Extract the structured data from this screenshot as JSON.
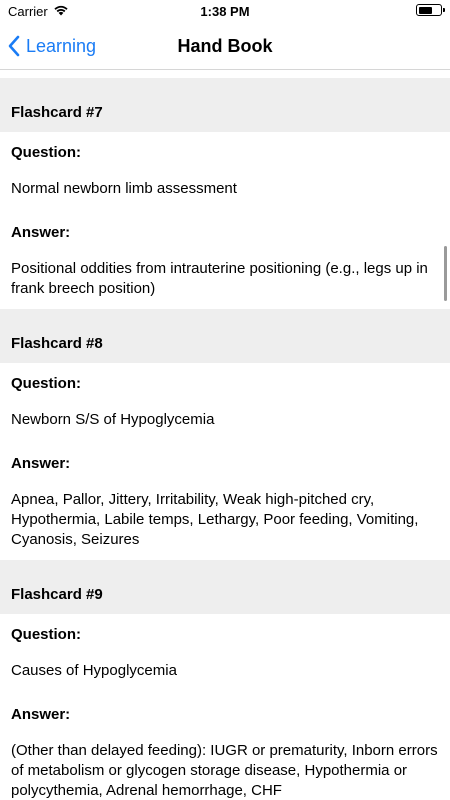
{
  "status_bar": {
    "carrier": "Carrier",
    "time": "1:38 PM"
  },
  "nav": {
    "back_label": "Learning",
    "title": "Hand Book"
  },
  "flashcards": [
    {
      "header": "Flashcard #7",
      "question_label": "Question:",
      "question": "Normal newborn limb assessment",
      "answer_label": "Answer:",
      "answer": "Positional oddities from intrauterine positioning (e.g., legs up in frank breech position)"
    },
    {
      "header": "Flashcard #8",
      "question_label": "Question:",
      "question": "Newborn S/S of Hypoglycemia",
      "answer_label": "Answer:",
      "answer": "Apnea, Pallor, Jittery, Irritability, Weak high-pitched cry, Hypothermia, Labile temps, Lethargy, Poor feeding, Vomiting, Cyanosis, Seizures"
    },
    {
      "header": "Flashcard #9",
      "question_label": "Question:",
      "question": "Causes of Hypoglycemia",
      "answer_label": "Answer:",
      "answer": "(Other than delayed feeding): IUGR or prematurity, Inborn errors of metabolism or glycogen storage disease, Hypothermia or polycythemia, Adrenal hemorrhage, CHF"
    }
  ],
  "colors": {
    "accent": "#1a7cf5",
    "section_bg": "#eeeeee"
  }
}
